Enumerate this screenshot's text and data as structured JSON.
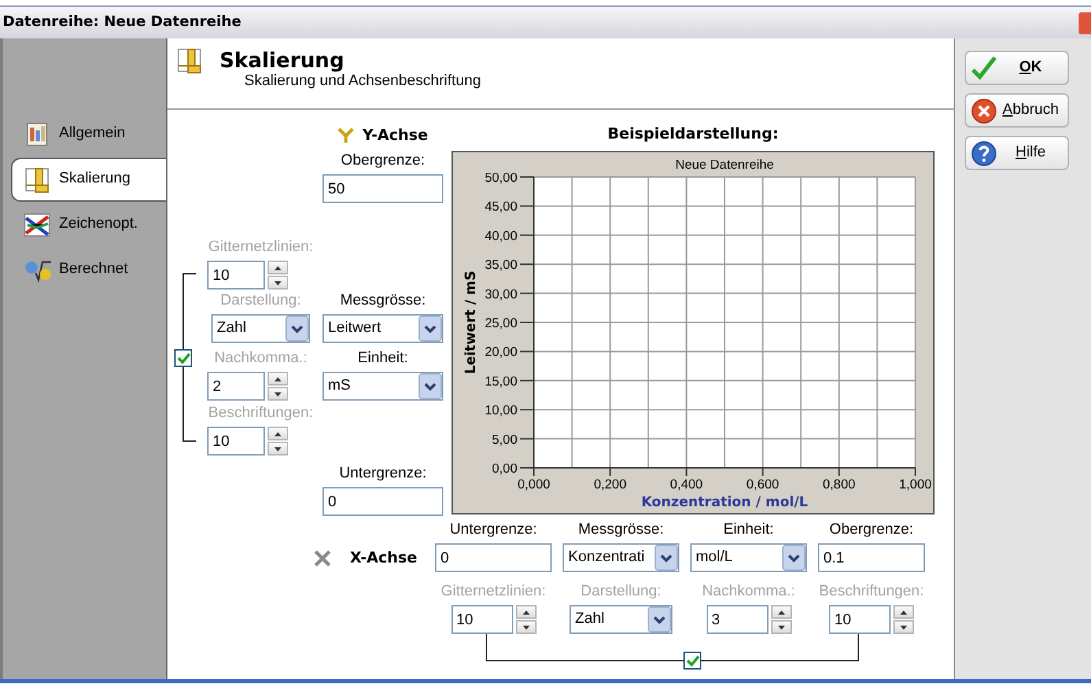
{
  "window": {
    "title": "Datenreihe: Neue Datenreihe"
  },
  "sidebar": {
    "items": [
      {
        "label": "Allgemein",
        "kind": "general",
        "selected": false
      },
      {
        "label": "Skalierung",
        "kind": "scale",
        "selected": true
      },
      {
        "label": "Zeichenopt.",
        "kind": "drawing",
        "selected": false
      },
      {
        "label": "Berechnet",
        "kind": "calculated",
        "selected": false
      }
    ]
  },
  "header": {
    "title": "Skalierung",
    "subtitle": "Skalierung und Achsenbeschriftung"
  },
  "y_axis": {
    "title": "Y-Achse",
    "upper_limit": {
      "kind": "text",
      "label": "Obergrenze:",
      "value": "50",
      "muted": false
    },
    "grid_lines": {
      "kind": "spin",
      "label": "Gitternetzlinien:",
      "value": "10",
      "muted": true
    },
    "format": {
      "kind": "select",
      "label": "Darstellung:",
      "value": "Zahl",
      "muted": true
    },
    "quantity": {
      "kind": "select",
      "label": "Messgrösse:",
      "value": "Leitwert",
      "muted": false
    },
    "decimals": {
      "kind": "spin",
      "label": "Nachkomma.:",
      "value": "2",
      "muted": true
    },
    "unit": {
      "kind": "select",
      "label": "Einheit:",
      "value": "mS",
      "muted": false
    },
    "labels": {
      "kind": "spin",
      "label": "Beschriftungen:",
      "value": "10",
      "muted": true
    },
    "lower_limit": {
      "kind": "text",
      "label": "Untergrenze:",
      "value": "0",
      "muted": false
    },
    "linked": {
      "checked": true
    }
  },
  "preview": {
    "title": "Beispieldarstellung:",
    "chart_data": {
      "type": "line",
      "title": "Neue Datenreihe",
      "xlabel": "Konzentration / mol/L",
      "ylabel": "Leitwert / mS",
      "xlim": [
        0,
        1
      ],
      "ylim": [
        0,
        50
      ],
      "grid": true,
      "xticks": [
        {
          "value": 0,
          "label": "0,000"
        },
        {
          "value": 0.2,
          "label": "0,200"
        },
        {
          "value": 0.4,
          "label": "0,400"
        },
        {
          "value": 0.6,
          "label": "0,600"
        },
        {
          "value": 0.8,
          "label": "0,800"
        },
        {
          "value": 1,
          "label": "1,000"
        }
      ],
      "yticks": [
        {
          "value": 0,
          "label": "0,00"
        },
        {
          "value": 5,
          "label": "5,00"
        },
        {
          "value": 10,
          "label": "10,00"
        },
        {
          "value": 15,
          "label": "15,00"
        },
        {
          "value": 20,
          "label": "20,00"
        },
        {
          "value": 25,
          "label": "25,00"
        },
        {
          "value": 30,
          "label": "30,00"
        },
        {
          "value": 35,
          "label": "35,00"
        },
        {
          "value": 40,
          "label": "40,00"
        },
        {
          "value": 45,
          "label": "45,00"
        },
        {
          "value": 50,
          "label": "50,00"
        }
      ]
    }
  },
  "x_axis": {
    "title": "X-Achse",
    "fields": [
      {
        "kind": "text",
        "label": "Untergrenze:",
        "value": "0",
        "muted": false
      },
      {
        "kind": "select",
        "label": "Messgrösse:",
        "value": "Konzentrati",
        "muted": false
      },
      {
        "kind": "select",
        "label": "Einheit:",
        "value": "mol/L",
        "muted": false
      },
      {
        "kind": "text",
        "label": "Obergrenze:",
        "value": "0.1",
        "muted": false
      },
      {
        "kind": "spin",
        "label": "Gitternetzlinien:",
        "value": "10",
        "muted": true
      },
      {
        "kind": "select",
        "label": "Darstellung:",
        "value": "Zahl",
        "muted": true
      },
      {
        "kind": "spin",
        "label": "Nachkomma.:",
        "value": "3",
        "muted": true
      },
      {
        "kind": "spin",
        "label": "Beschriftungen:",
        "value": "10",
        "muted": true
      }
    ],
    "linked": {
      "checked": true
    }
  },
  "buttons": [
    {
      "label": "OK",
      "kind": "ok"
    },
    {
      "label": "Abbruch",
      "kind": "cancel"
    },
    {
      "label": "Hilfe",
      "kind": "help"
    }
  ]
}
